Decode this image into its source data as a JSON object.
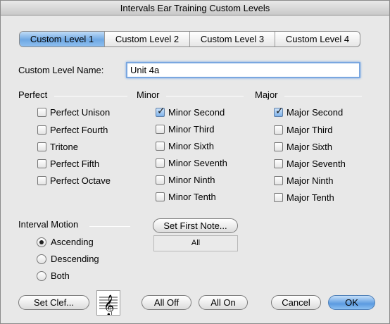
{
  "window": {
    "title": "Intervals Ear Training Custom Levels"
  },
  "tabs": [
    {
      "label": "Custom Level 1",
      "active": true
    },
    {
      "label": "Custom Level 2",
      "active": false
    },
    {
      "label": "Custom Level 3",
      "active": false
    },
    {
      "label": "Custom Level 4",
      "active": false
    }
  ],
  "name_field": {
    "label": "Custom Level Name:",
    "value": "Unit 4a"
  },
  "perfect": {
    "title": "Perfect",
    "items": [
      {
        "label": "Perfect Unison",
        "checked": false
      },
      {
        "label": "Perfect Fourth",
        "checked": false
      },
      {
        "label": "Tritone",
        "checked": false
      },
      {
        "label": "Perfect Fifth",
        "checked": false
      },
      {
        "label": "Perfect Octave",
        "checked": false
      }
    ]
  },
  "minor": {
    "title": "Minor",
    "items": [
      {
        "label": "Minor Second",
        "checked": true
      },
      {
        "label": "Minor Third",
        "checked": false
      },
      {
        "label": "Minor Sixth",
        "checked": false
      },
      {
        "label": "Minor Seventh",
        "checked": false
      },
      {
        "label": "Minor Ninth",
        "checked": false
      },
      {
        "label": "Minor Tenth",
        "checked": false
      }
    ]
  },
  "major": {
    "title": "Major",
    "items": [
      {
        "label": "Major Second",
        "checked": true
      },
      {
        "label": "Major Third",
        "checked": false
      },
      {
        "label": "Major Sixth",
        "checked": false
      },
      {
        "label": "Major Seventh",
        "checked": false
      },
      {
        "label": "Major Ninth",
        "checked": false
      },
      {
        "label": "Major Tenth",
        "checked": false
      }
    ]
  },
  "motion": {
    "title": "Interval Motion",
    "options": [
      {
        "label": "Ascending",
        "selected": true
      },
      {
        "label": "Descending",
        "selected": false
      },
      {
        "label": "Both",
        "selected": false
      }
    ]
  },
  "first_note": {
    "button_label": "Set First Note...",
    "value": "All"
  },
  "buttons": {
    "set_clef": "Set Clef...",
    "all_off": "All Off",
    "all_on": "All On",
    "cancel": "Cancel",
    "ok": "OK"
  },
  "clef_icon": "treble-clef-icon",
  "colors": {
    "accent": "#6fa8e3",
    "default_button": "#5b9be0"
  }
}
